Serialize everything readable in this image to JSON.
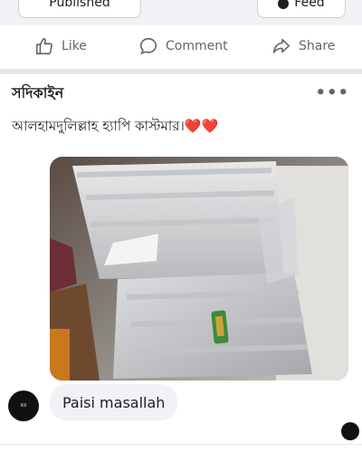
{
  "top_buttons": {
    "left_label": "Published",
    "right_label": "Feed"
  },
  "actions": {
    "like": "Like",
    "comment": "Comment",
    "share": "Share"
  },
  "post": {
    "author": "সদিকাইন",
    "text": "আলহামদুলিল্লাহ হ্যাপি কাস্টমার।❤️❤️",
    "more_icon": "more-dots-icon"
  },
  "comment": {
    "text": "Paisi masallah"
  },
  "colors": {
    "icon_gray": "#606770",
    "bubble_bg": "#f0f2f5",
    "separator": "#e4e6eb"
  }
}
